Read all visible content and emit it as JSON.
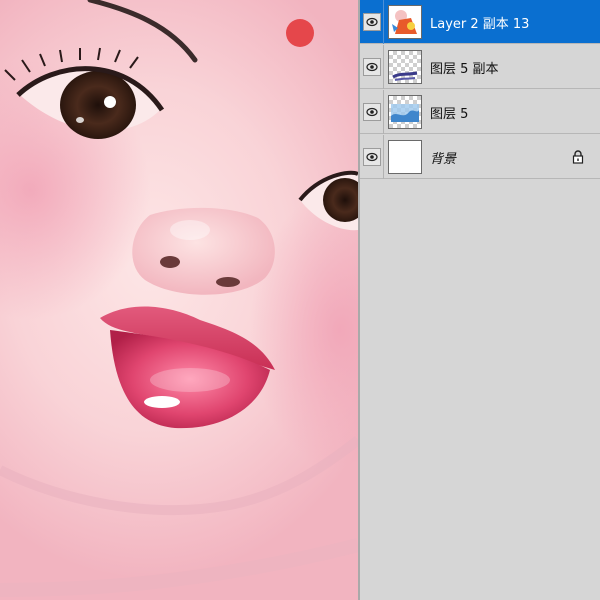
{
  "layers_panel": {
    "layers": [
      {
        "name": "Layer 2 副本 13",
        "selected": true,
        "visible": true,
        "thumbnail": "colorful-figure-thumb",
        "locked": false
      },
      {
        "name": "图层 5 副本",
        "selected": false,
        "visible": true,
        "thumbnail": "transparent-strokes-thumb",
        "locked": false
      },
      {
        "name": "图层 5",
        "selected": false,
        "visible": true,
        "thumbnail": "blue-pattern-thumb",
        "locked": false
      },
      {
        "name": "背景",
        "selected": false,
        "visible": true,
        "thumbnail": "white-thumb",
        "locked": true
      }
    ],
    "icons": {
      "visibility": "eye-icon",
      "lock": "lock-icon"
    }
  },
  "colors": {
    "selection": "#0a6fd0",
    "panel_bg": "#d6d6d6",
    "skin": "#f9d3d7",
    "bindi": "#e5474b",
    "lips": "#d8345a"
  }
}
